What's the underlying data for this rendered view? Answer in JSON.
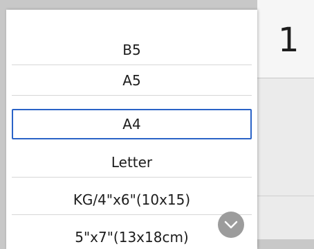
{
  "copies_value": "1",
  "paper_size_list": {
    "options": [
      {
        "label": "B5"
      },
      {
        "label": "A5"
      },
      {
        "label": "A4",
        "selected": true
      },
      {
        "label": "Letter"
      },
      {
        "label": "KG/4\"x6\"(10x15)"
      },
      {
        "label": "5\"x7\"(13x18cm)"
      }
    ]
  },
  "icons": {
    "scroll_down": "chevron-down-icon"
  },
  "colors": {
    "selection_border": "#2a63c7",
    "scroll_button": "#9c9c9c"
  }
}
